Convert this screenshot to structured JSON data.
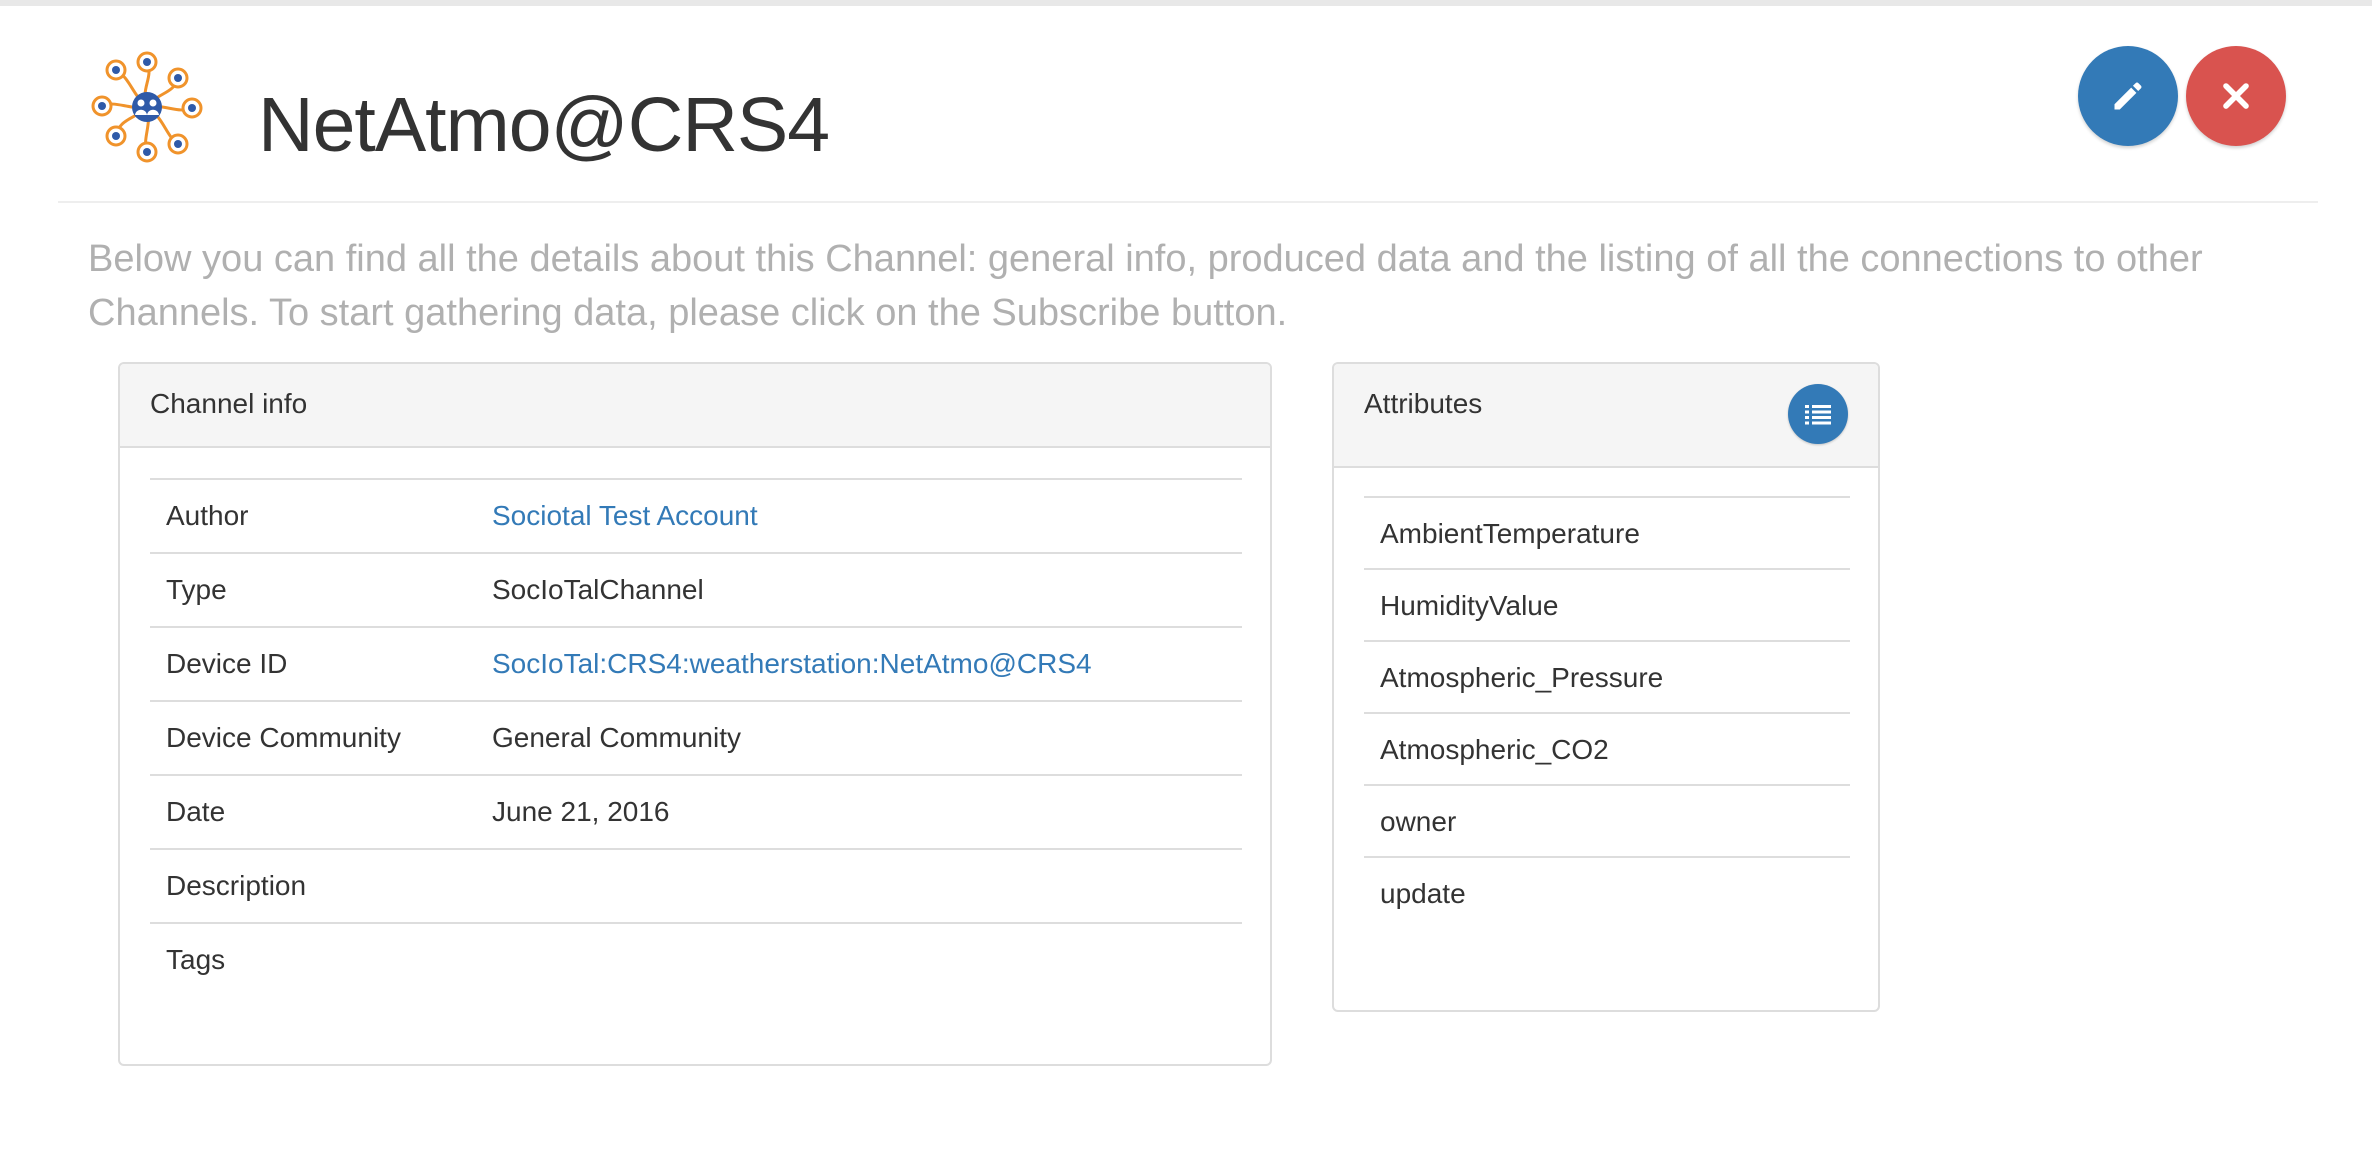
{
  "header": {
    "title": "NetAtmo@CRS4",
    "logo_icon": "sociotal-logo-icon",
    "edit_icon": "pencil-icon",
    "close_icon": "close-icon"
  },
  "intro_text": "Below you can find all the details about this Channel: general info, produced data and the listing of all the connections to other Channels. To start gathering data, please click on the Subscribe button.",
  "channel_info": {
    "title": "Channel info",
    "rows": [
      {
        "label": "Author",
        "value": "Sociotal Test Account"
      },
      {
        "label": "Type",
        "value": "SocIoTalChannel"
      },
      {
        "label": "Device ID",
        "value": "SocIoTal:CRS4:weatherstation:NetAtmo@CRS4"
      },
      {
        "label": "Device Community",
        "value": "General Community"
      },
      {
        "label": "Date",
        "value": "June 21, 2016"
      },
      {
        "label": "Description",
        "value": ""
      },
      {
        "label": "Tags",
        "value": ""
      }
    ]
  },
  "attributes": {
    "title": "Attributes",
    "list_icon": "list-icon",
    "items": [
      "AmbientTemperature",
      "HumidityValue",
      "Atmospheric_Pressure",
      "Atmospheric_CO2",
      "owner",
      "update"
    ]
  },
  "colors": {
    "primary": "#337ab7",
    "danger": "#d9534f",
    "logo_orange": "#f0932b",
    "logo_blue": "#2f5aa8",
    "muted_text": "#b0b0b0"
  }
}
